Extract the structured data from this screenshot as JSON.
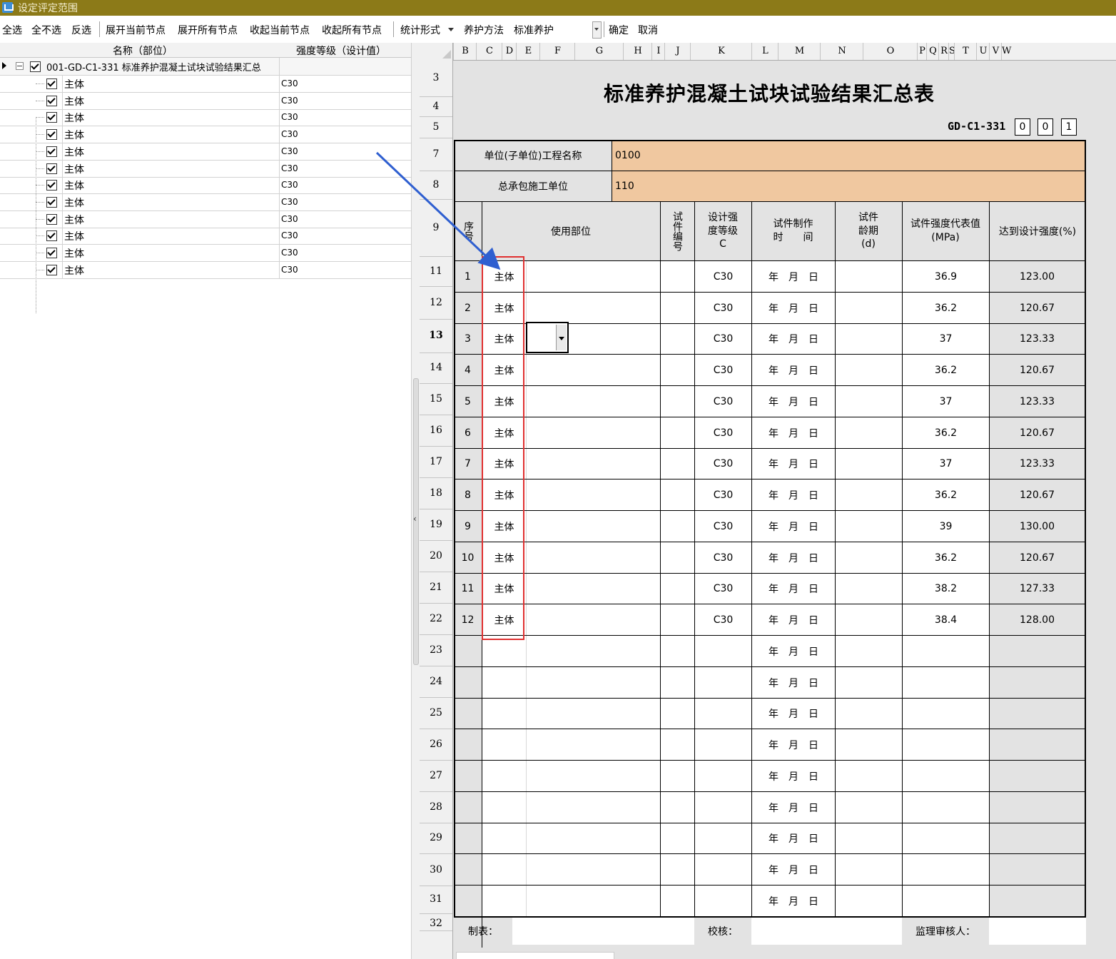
{
  "window": {
    "title": "设定评定范围"
  },
  "toolbar": {
    "select_all": "全选",
    "select_none": "全不选",
    "invert": "反选",
    "expand_current": "展开当前节点",
    "expand_all": "展开所有节点",
    "collapse_current": "收起当前节点",
    "collapse_all": "收起所有节点",
    "stat_form": "统计形式",
    "cure_method_label": "养护方法",
    "cure_method_value": "标准养护",
    "confirm": "确定",
    "cancel": "取消"
  },
  "tree": {
    "col_name": "名称（部位）",
    "col_grade": "强度等级（设计值）",
    "root_label": "001-GD-C1-331 标准养护混凝土试块试验结果汇总",
    "children": [
      {
        "name": "主体",
        "grade": "C30"
      },
      {
        "name": "主体",
        "grade": "C30"
      },
      {
        "name": "主体",
        "grade": "C30"
      },
      {
        "name": "主体",
        "grade": "C30"
      },
      {
        "name": "主体",
        "grade": "C30"
      },
      {
        "name": "主体",
        "grade": "C30"
      },
      {
        "name": "主体",
        "grade": "C30"
      },
      {
        "name": "主体",
        "grade": "C30"
      },
      {
        "name": "主体",
        "grade": "C30"
      },
      {
        "name": "主体",
        "grade": "C30"
      },
      {
        "name": "主体",
        "grade": "C30"
      },
      {
        "name": "主体",
        "grade": "C30"
      }
    ]
  },
  "sheet": {
    "columns": [
      "B",
      "C",
      "D",
      "E",
      "F",
      "G",
      "H",
      "I",
      "J",
      "K",
      "L",
      "M",
      "N",
      "O",
      "P",
      "Q",
      "R",
      "S",
      "T",
      "U",
      "V",
      "W"
    ],
    "row_numbers": [
      "3",
      "4",
      "5",
      "7",
      "8",
      "9",
      "11",
      "12",
      "13",
      "14",
      "15",
      "16",
      "17",
      "18",
      "19",
      "20",
      "21",
      "22",
      "23",
      "24",
      "25",
      "26",
      "27",
      "28",
      "29",
      "30",
      "31",
      "32"
    ],
    "title": "标准养护混凝土试块试验结果汇总表",
    "doc_code": "GD-C1-331",
    "doc_digits": [
      "0",
      "0",
      "1"
    ],
    "unit_label": "单位(子单位)工程名称",
    "unit_value": "0100",
    "contractor_label": "总承包施工单位",
    "contractor_value": "110",
    "headers": {
      "seq": "序号",
      "part": "使用部位",
      "specimen_no": "试件编号",
      "design_grade_l1": "设计强",
      "design_grade_l2": "度等级",
      "design_grade_l3": "C",
      "make_time_l1": "试件制作",
      "make_time_l2": "时　　间",
      "age_l1": "试件",
      "age_l2": "龄期",
      "age_l3": "(d)",
      "strength_l1": "试件强度代表值",
      "strength_l2": "(MPa)",
      "percent": "达到设计强度(%)"
    },
    "date_text": "年　月　日",
    "rows": [
      {
        "seq": "1",
        "part": "主体",
        "grade": "C30",
        "strength": "36.9",
        "percent": "123.00"
      },
      {
        "seq": "2",
        "part": "主体",
        "grade": "C30",
        "strength": "36.2",
        "percent": "120.67"
      },
      {
        "seq": "3",
        "part": "主体",
        "grade": "C30",
        "strength": "37",
        "percent": "123.33"
      },
      {
        "seq": "4",
        "part": "主体",
        "grade": "C30",
        "strength": "36.2",
        "percent": "120.67"
      },
      {
        "seq": "5",
        "part": "主体",
        "grade": "C30",
        "strength": "37",
        "percent": "123.33"
      },
      {
        "seq": "6",
        "part": "主体",
        "grade": "C30",
        "strength": "36.2",
        "percent": "120.67"
      },
      {
        "seq": "7",
        "part": "主体",
        "grade": "C30",
        "strength": "37",
        "percent": "123.33"
      },
      {
        "seq": "8",
        "part": "主体",
        "grade": "C30",
        "strength": "36.2",
        "percent": "120.67"
      },
      {
        "seq": "9",
        "part": "主体",
        "grade": "C30",
        "strength": "39",
        "percent": "130.00"
      },
      {
        "seq": "10",
        "part": "主体",
        "grade": "C30",
        "strength": "36.2",
        "percent": "120.67"
      },
      {
        "seq": "11",
        "part": "主体",
        "grade": "C30",
        "strength": "38.2",
        "percent": "127.33"
      },
      {
        "seq": "12",
        "part": "主体",
        "grade": "C30",
        "strength": "38.4",
        "percent": "128.00"
      }
    ],
    "empty_row_count": 9,
    "footer": {
      "maker": "制表：",
      "checker": "校核：",
      "supervisor": "监理审核人："
    }
  }
}
